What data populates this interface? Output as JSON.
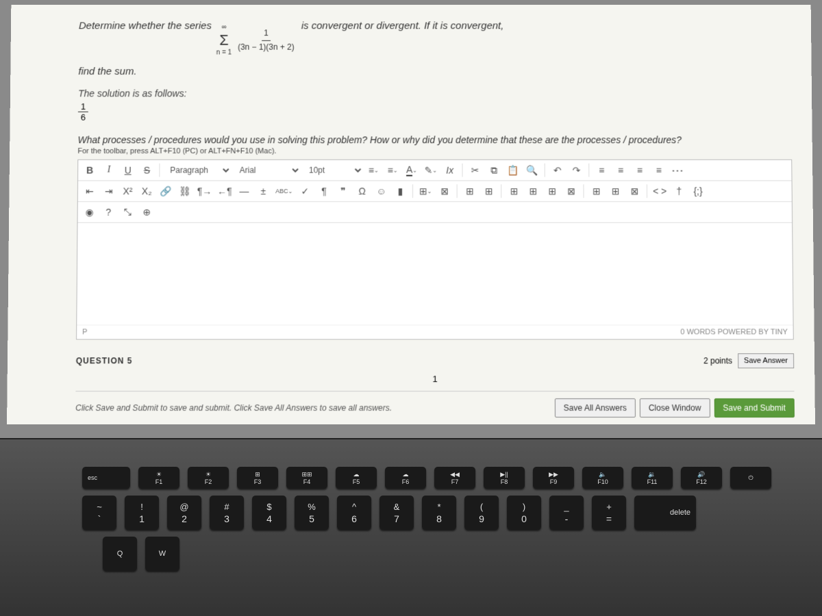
{
  "question": {
    "prefix": "Determine whether the series",
    "sigma_top": "∞",
    "sigma_bottom": "n = 1",
    "frac_num": "1",
    "frac_den": "(3n − 1)(3n + 2)",
    "suffix": "is convergent or divergent. If it is convergent,",
    "line2": "find the sum."
  },
  "solution": {
    "label": "The solution is as follows:",
    "num": "1",
    "den": "6"
  },
  "subq": "What processes / procedures would you use in solving this problem? How or why did you determine that these are the processes / procedures?",
  "toolbar_hint": "For the toolbar, press ALT+F10 (PC) or ALT+FN+F10 (Mac).",
  "editor": {
    "bold": "B",
    "italic": "I",
    "underline": "U",
    "strike": "S",
    "block": "Paragraph",
    "font": "Arial",
    "size": "10pt",
    "text_color": "A",
    "clear_fmt": "Ix",
    "sup": "X²",
    "sub": "X₂",
    "ltr": "¶",
    "rtl": "¶",
    "minus": "—",
    "plus": "±",
    "abc": "ABC",
    "check": "✓",
    "para": "¶",
    "quote": "❞",
    "omega": "Ω",
    "emoji": "☺",
    "bookmark_i": "▮",
    "table": "⊞",
    "xbox": "⊠",
    "code": "< >",
    "access": "†",
    "braces": "{;}",
    "fullscreen": "⛶",
    "help": "?",
    "expand": "⤡",
    "plus_circle": "⊕",
    "footer_path": "P",
    "footer_right": "0 WORDS  POWERED BY TINY"
  },
  "q5": {
    "title": "QUESTION 5",
    "points": "2 points",
    "save": "Save Answer",
    "num": "1"
  },
  "bottom": {
    "hint": "Click Save and Submit to save and submit. Click Save All Answers to save all answers.",
    "save_all": "Save All Answers",
    "close": "Close Window",
    "submit": "Save and Submit"
  },
  "keyboard": {
    "esc": "esc",
    "fn": [
      "F1",
      "F2",
      "F3",
      "F4",
      "F5",
      "F6",
      "F7",
      "F8",
      "F9",
      "F10",
      "F11",
      "F12"
    ],
    "fn_icons": [
      "☀",
      "☀",
      "⊞",
      "⊞⊞",
      "☁",
      "☁",
      "◀◀",
      "▶||",
      "▶▶",
      "🔈",
      "🔉",
      "🔊"
    ],
    "row2_top": [
      "~",
      "!",
      "@",
      "#",
      "$",
      "%",
      "^",
      "&",
      "*",
      "(",
      ")",
      "_",
      "+"
    ],
    "row2_bot": [
      "`",
      "1",
      "2",
      "3",
      "4",
      "5",
      "6",
      "7",
      "8",
      "9",
      "0",
      "-",
      "="
    ],
    "delete": "delete",
    "row3": [
      "Q",
      "W"
    ]
  }
}
